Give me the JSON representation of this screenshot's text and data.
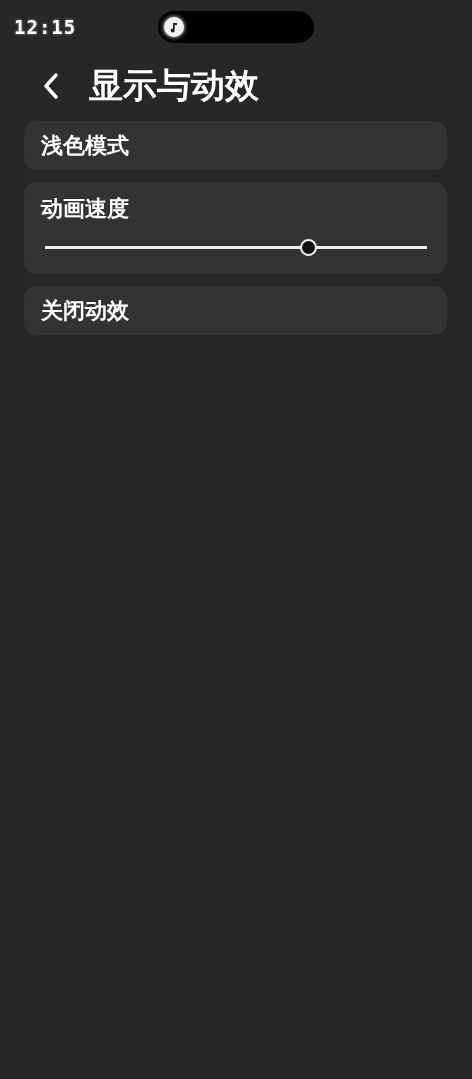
{
  "status_bar": {
    "time": "12:15"
  },
  "header": {
    "title": "显示与动效"
  },
  "settings": [
    {
      "kind": "plain",
      "label": "浅色模式"
    },
    {
      "kind": "slider",
      "label": "动画速度",
      "level": 0.69
    },
    {
      "kind": "plain",
      "label": "关闭动效"
    }
  ]
}
